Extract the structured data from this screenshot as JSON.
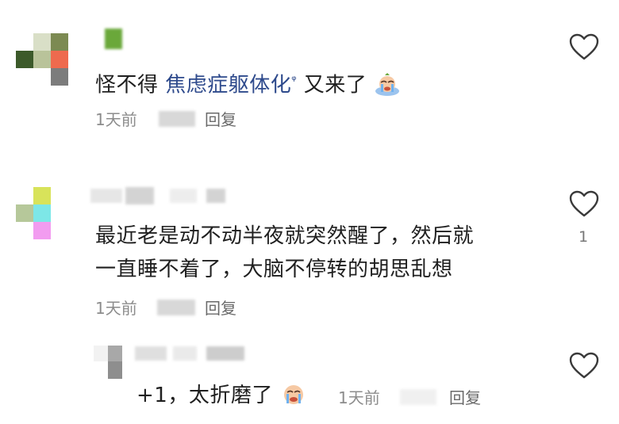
{
  "comments": [
    {
      "text_before": "怪不得",
      "topic": "焦虑症躯体化",
      "text_after": "又来了",
      "time": "1天前",
      "reply_label": "回复"
    },
    {
      "line1": "最近老是动不动半夜就突然醒了，然后就",
      "line2": "一直睡不着了，大脑不停转的胡思乱想",
      "time": "1天前",
      "reply_label": "回复",
      "like_count": "1"
    },
    {
      "text": "+1，太折磨了",
      "time": "1天前",
      "reply_label": "回复"
    }
  ],
  "icons": {
    "like": "heart-outline-icon",
    "topic": "search-icon",
    "emoji_cry": "crying-emoji-icon"
  },
  "colors": {
    "topic_link": "#2e4a8c",
    "meta": "#8c8c8c",
    "text": "#1f1f1f"
  }
}
